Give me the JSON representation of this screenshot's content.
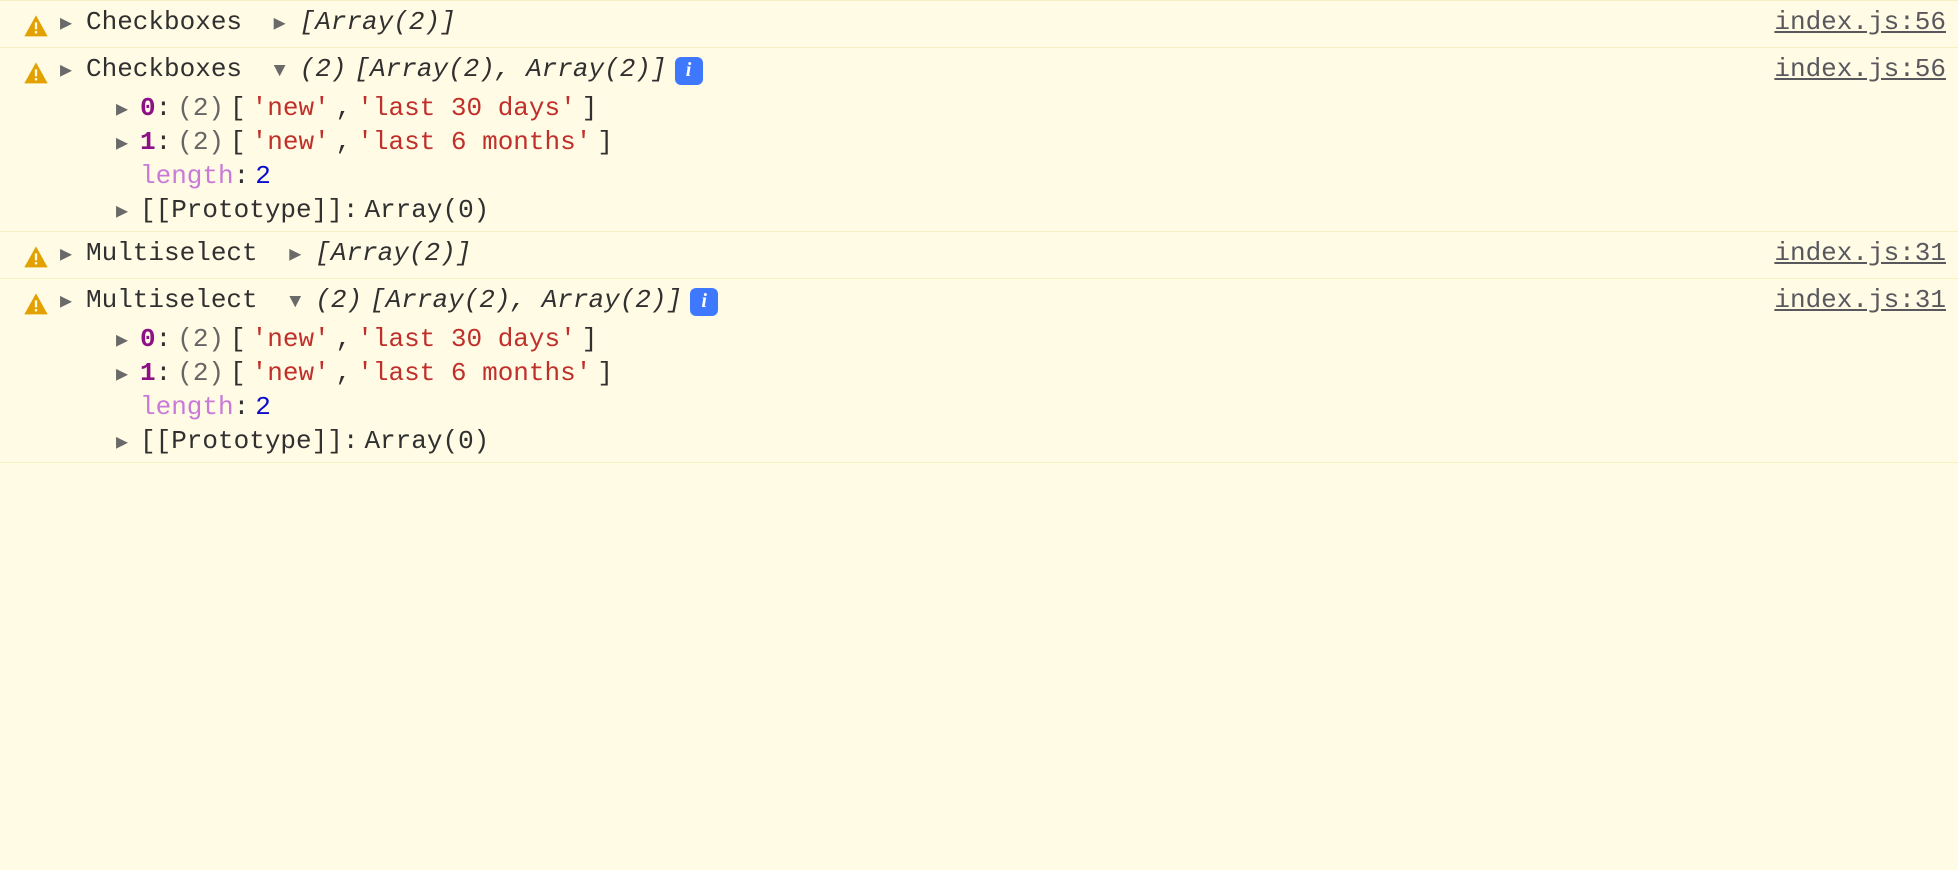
{
  "entries": [
    {
      "label": "Checkboxes",
      "collapsed_preview": "[Array(2)]",
      "expanded": false,
      "source": "index.js:56"
    },
    {
      "label": "Checkboxes",
      "expanded": true,
      "count": "(2)",
      "expanded_preview": "[Array(2), Array(2)]",
      "info": "i",
      "source": "index.js:56",
      "items": [
        {
          "index": "0",
          "count": "(2)",
          "values": [
            "'new'",
            "'last 30 days'"
          ]
        },
        {
          "index": "1",
          "count": "(2)",
          "values": [
            "'new'",
            "'last 6 months'"
          ]
        }
      ],
      "length_key": "length",
      "length_val": "2",
      "proto_key": "[[Prototype]]",
      "proto_val": "Array(0)"
    },
    {
      "label": "Multiselect",
      "collapsed_preview": "[Array(2)]",
      "expanded": false,
      "source": "index.js:31"
    },
    {
      "label": "Multiselect",
      "expanded": true,
      "count": "(2)",
      "expanded_preview": "[Array(2), Array(2)]",
      "info": "i",
      "source": "index.js:31",
      "items": [
        {
          "index": "0",
          "count": "(2)",
          "values": [
            "'new'",
            "'last 30 days'"
          ]
        },
        {
          "index": "1",
          "count": "(2)",
          "values": [
            "'new'",
            "'last 6 months'"
          ]
        }
      ],
      "length_key": "length",
      "length_val": "2",
      "proto_key": "[[Prototype]]",
      "proto_val": "Array(0)"
    }
  ]
}
